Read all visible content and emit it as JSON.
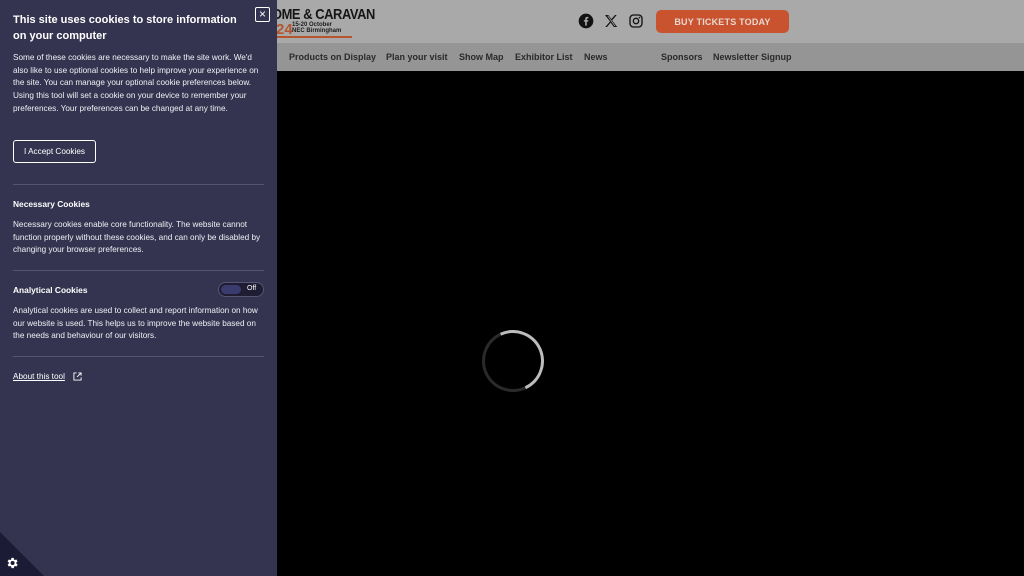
{
  "header": {
    "logo_line1": "OME & CARAVAN",
    "logo_year": "24",
    "logo_dates": "15-20 October",
    "logo_venue": "NEC Birmingham",
    "buy_button": "BUY TICKETS TODAY",
    "social_icons": [
      "facebook-icon",
      "x-icon",
      "instagram-icon"
    ]
  },
  "nav": {
    "items": [
      "Products on Display",
      "Plan your visit",
      "Show Map",
      "Exhibitor List",
      "News",
      "Sponsors",
      "Newsletter Signup"
    ]
  },
  "cookie_panel": {
    "title": "This site uses cookies to store information on your computer",
    "intro": "Some of these cookies are necessary to make the site work. We'd also like to use optional cookies to help improve your experience on the site. You can manage your optional cookie preferences below. Using this tool will set a cookie on your device to remember your preferences. Your preferences can be changed at any time.",
    "accept_button": "I Accept Cookies",
    "close_symbol": "×",
    "necessary": {
      "title": "Necessary Cookies",
      "text": "Necessary cookies enable core functionality. The website cannot function properly without these cookies, and can only be disabled by changing your browser preferences."
    },
    "analytical": {
      "title": "Analytical Cookies",
      "toggle_state": "Off",
      "text": "Analytical cookies are used to collect and report information on how our website is used. This helps us to improve the website based on the needs and behaviour of our visitors."
    },
    "about_link": "About this tool"
  },
  "colors": {
    "panel_bg": "#353450",
    "buy_button": "#c9532f",
    "page_bg": "#000000"
  }
}
